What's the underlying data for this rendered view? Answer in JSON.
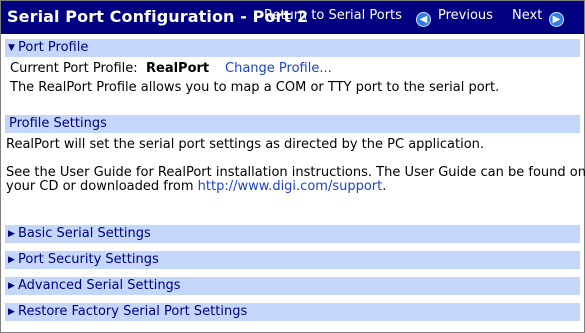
{
  "header": {
    "title": "Serial Port Configuration - Port 2",
    "return_link": "Return to Serial Ports",
    "previous_label": "Previous",
    "next_label": "Next"
  },
  "port_profile": {
    "heading": "Port Profile",
    "current_label": "Current Port Profile:",
    "current_value": "RealPort",
    "change_link": "Change Profile...",
    "description": "The RealPort Profile allows you to map a COM or TTY port to the serial port."
  },
  "profile_settings": {
    "heading": "Profile Settings",
    "line1": "RealPort will set the serial port settings as directed by the PC application.",
    "line2": "See the User Guide for RealPort installation instructions. The User Guide can be found on",
    "line3_prefix": "your CD or downloaded from ",
    "line3_link": "http://www.digi.com/support",
    "line3_suffix": "."
  },
  "collapsed_sections": [
    {
      "label": "Basic Serial Settings"
    },
    {
      "label": "Port Security Settings"
    },
    {
      "label": "Advanced Serial Settings"
    },
    {
      "label": "Restore Factory Serial Port Settings"
    }
  ],
  "icons": {
    "expanded": "triangle-down-icon",
    "collapsed": "triangle-right-icon",
    "previous": "arrow-left-circle-icon",
    "next": "arrow-right-circle-icon"
  },
  "colors": {
    "title_bar": "#000080",
    "section_bg": "#c5d6fb",
    "link": "#1a45c2"
  }
}
